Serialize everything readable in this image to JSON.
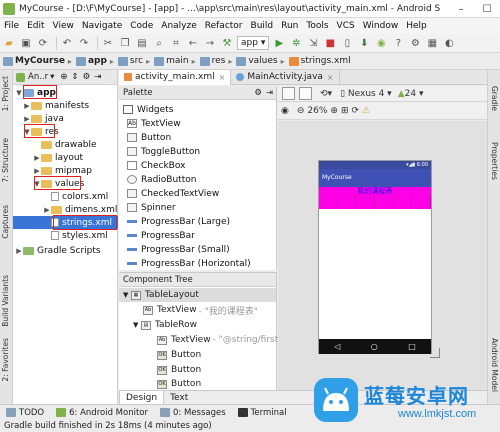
{
  "window": {
    "title": "MyCourse - [D:\\F\\MyCourse] - [app] - ...\\app\\src\\main\\res\\layout\\activity_main.xml - Android S"
  },
  "menu": [
    "File",
    "Edit",
    "View",
    "Navigate",
    "Code",
    "Analyze",
    "Refactor",
    "Build",
    "Run",
    "Tools",
    "VCS",
    "Window",
    "Help"
  ],
  "toolbar": {
    "run_config": "app"
  },
  "breadcrumb": [
    "MyCourse",
    "app",
    "src",
    "main",
    "res",
    "values",
    "strings.xml"
  ],
  "left_strip": [
    "1: Project",
    "7: Structure",
    "Captures",
    "Build Variants",
    "2: Favorites"
  ],
  "right_strip": [
    "Gradle",
    "Properties",
    "Android Model"
  ],
  "project": {
    "view_label": "An..r",
    "tree": [
      {
        "label": "app",
        "arrow": "▼",
        "icon": "folder",
        "bold": true
      },
      {
        "label": "manifests",
        "arrow": "▶",
        "icon": "folder"
      },
      {
        "label": "java",
        "arrow": "▶",
        "icon": "folder"
      },
      {
        "label": "res",
        "arrow": "▼",
        "icon": "folder"
      },
      {
        "label": "drawable",
        "arrow": "",
        "icon": "folder"
      },
      {
        "label": "layout",
        "arrow": "▶",
        "icon": "folder"
      },
      {
        "label": "mipmap",
        "arrow": "▶",
        "icon": "folder"
      },
      {
        "label": "values",
        "arrow": "▼",
        "icon": "folder"
      },
      {
        "label": "colors.xml",
        "arrow": "",
        "icon": "file"
      },
      {
        "label": "dimens.xml",
        "arrow": "▶",
        "icon": "folder"
      },
      {
        "label": "strings.xml",
        "arrow": "",
        "icon": "file",
        "selected": true
      },
      {
        "label": "styles.xml",
        "arrow": "",
        "icon": "file"
      },
      {
        "label": "Gradle Scripts",
        "arrow": "▶",
        "icon": "gradle"
      }
    ]
  },
  "editor_tabs": [
    {
      "label": "activity_main.xml",
      "active": true
    },
    {
      "label": "MainActivity.java",
      "active": false
    }
  ],
  "palette": {
    "title": "Palette",
    "group": "Widgets",
    "items": [
      "TextView",
      "Button",
      "ToggleButton",
      "CheckBox",
      "RadioButton",
      "CheckedTextView",
      "Spinner",
      "ProgressBar (Large)",
      "ProgressBar",
      "ProgressBar (Small)",
      "ProgressBar (Horizontal)"
    ]
  },
  "component_tree": {
    "title": "Component Tree",
    "items": [
      {
        "label": "TableLayout",
        "hint": ""
      },
      {
        "label": "TextView",
        "hint": "- \"我的课程表\""
      },
      {
        "label": "TableRow",
        "hint": ""
      },
      {
        "label": "TextView",
        "hint": "- \"@string/first\""
      },
      {
        "label": "Button",
        "hint": ""
      },
      {
        "label": "Button",
        "hint": ""
      },
      {
        "label": "Button",
        "hint": ""
      }
    ]
  },
  "designer": {
    "device": "Nexus 4",
    "api": "24",
    "zoom": "26%"
  },
  "preview": {
    "status_time": "6:00",
    "app_title": "MyCourse",
    "heading": "我的课程表",
    "nav": [
      "◁",
      "○",
      "□"
    ]
  },
  "design_tabs": [
    "Design",
    "Text"
  ],
  "bottom_tabs": [
    "TODO",
    "6: Android Monitor",
    "0: Messages",
    "Terminal"
  ],
  "status": "Gradle build finished in 2s 18ms (4 minutes ago)",
  "watermark": {
    "name": "蓝莓安卓网",
    "url": "www.lmkjst.com"
  },
  "colors": {
    "selection": "#3875d7",
    "highlight_box": "#e02020",
    "preview_accent": "#ff00e6",
    "action_bar": "#3f51b5"
  }
}
